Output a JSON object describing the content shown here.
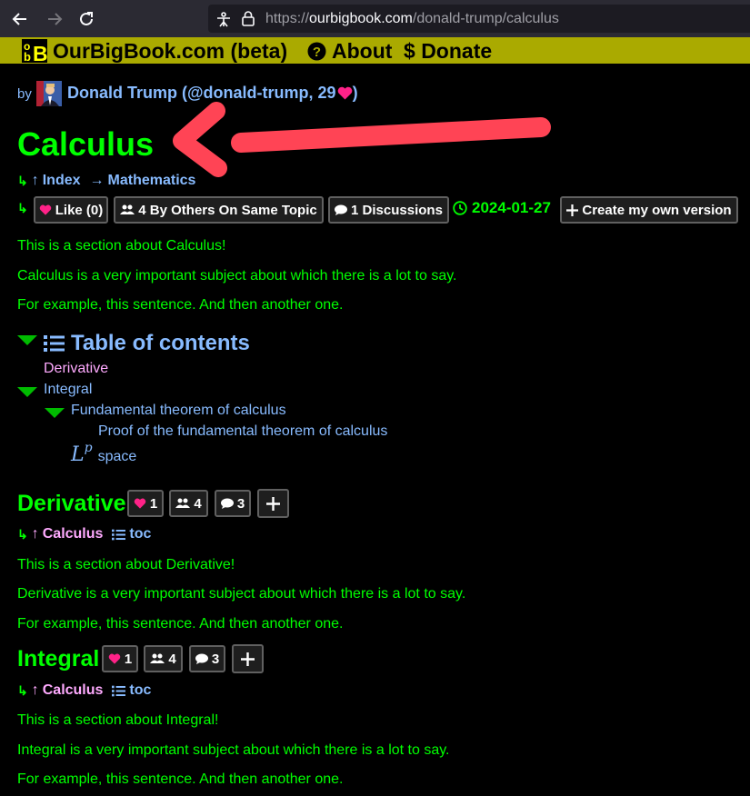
{
  "browser": {
    "url_prefix": "https://",
    "url_host": "ourbigbook.com",
    "url_path": "/donald-trump/calculus"
  },
  "site": {
    "logo_text": "OB",
    "name": "OurBigBook.com (beta)",
    "about": "About",
    "donate": "Donate"
  },
  "author": {
    "by": "by",
    "name": "Donald Trump (@donald-trump, 29",
    "close": ")"
  },
  "article": {
    "title": "Calculus",
    "nav_index": "Index",
    "nav_parent": "Mathematics",
    "like": "Like (0)",
    "others": "4 By Others On Same Topic",
    "discussions": "1 Discussions",
    "date": "2024-01-27",
    "create": "Create my own version",
    "paragraphs": [
      "This is a section about Calculus!",
      "Calculus is a very important subject about which there is a lot to say.",
      "For example, this sentence. And then another one."
    ]
  },
  "toc": {
    "title": "Table of contents",
    "items": [
      "Derivative",
      "Integral",
      "Fundamental theorem of calculus",
      "Proof of the fundamental theorem of calculus",
      "space"
    ],
    "math_base": "L",
    "math_sup": "p"
  },
  "sections": [
    {
      "title": "Derivative",
      "likes": "1",
      "others": "4",
      "discussions": "3",
      "parent": "Calculus",
      "toc": "toc",
      "paragraphs": [
        "This is a section about Derivative!",
        "Derivative is a very important subject about which there is a lot to say.",
        "For example, this sentence. And then another one."
      ]
    },
    {
      "title": "Integral",
      "likes": "1",
      "others": "4",
      "discussions": "3",
      "parent": "Calculus",
      "toc": "toc",
      "paragraphs": [
        "This is a section about Integral!",
        "Integral is a very important subject about which there is a lot to say.",
        "For example, this sentence. And then another one."
      ]
    }
  ],
  "colors": {
    "background": "#000000",
    "text_green": "#00ff00",
    "link_blue": "#88bbff",
    "link_pink": "#ff88ff",
    "site_bar": "#aaaa00",
    "heart": "#ff2288",
    "arrow_annotation": "#ff4455"
  }
}
